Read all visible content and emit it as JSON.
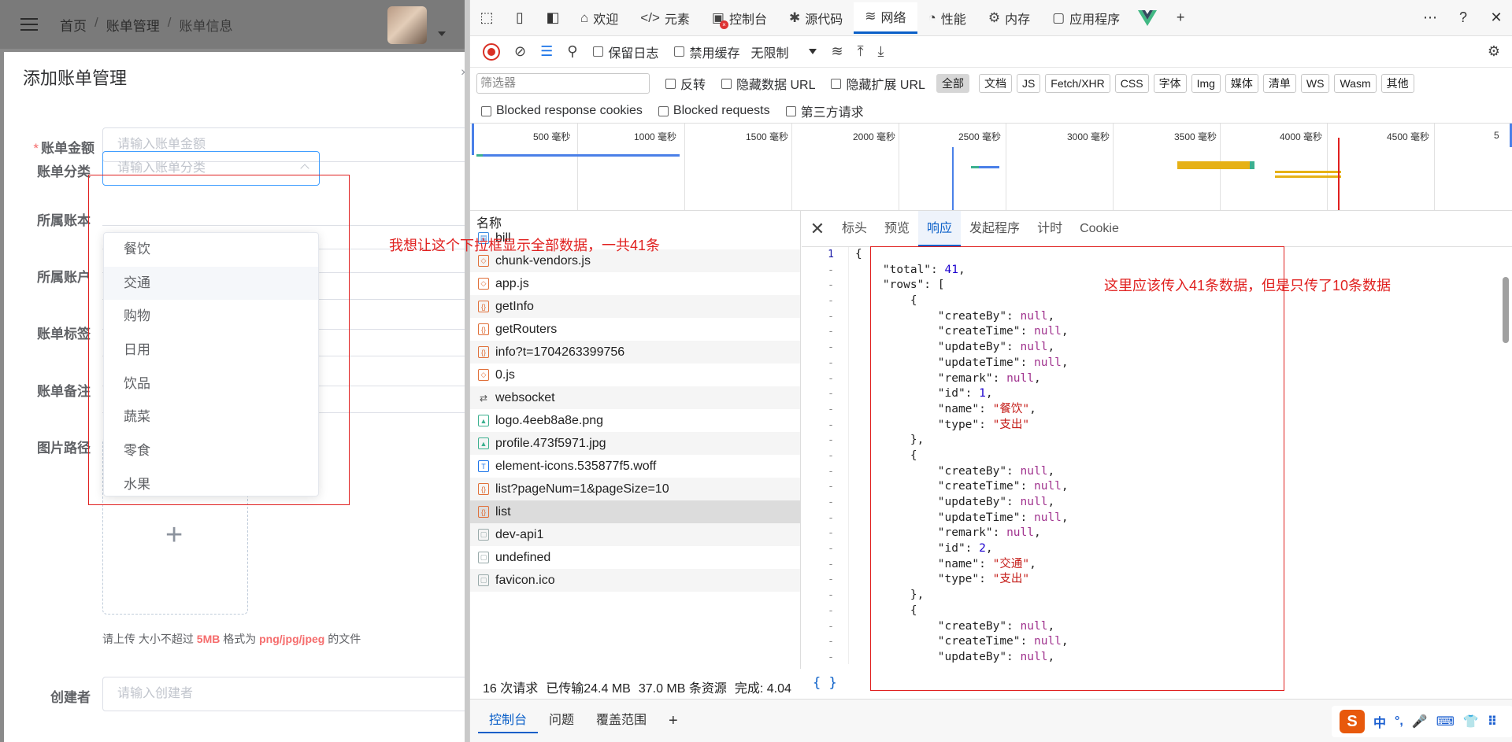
{
  "app": {
    "breadcrumb": [
      "首页",
      "账单管理",
      "账单信息"
    ],
    "dialog_title": "添加账单管理",
    "fields": {
      "amount": {
        "label": "账单金额",
        "placeholder": "请输入账单金额"
      },
      "category": {
        "label": "账单分类",
        "placeholder": "请输入账单分类"
      },
      "book": {
        "label": "所属账本"
      },
      "account": {
        "label": "所属账户"
      },
      "tag": {
        "label": "账单标签"
      },
      "remark": {
        "label": "账单备注"
      },
      "image": {
        "label": "图片路径"
      },
      "creator": {
        "label": "创建者",
        "placeholder": "请输入创建者"
      }
    },
    "upload_tip": {
      "pre": "请上传 大小不超过 ",
      "size": "5MB",
      "mid": " 格式为 ",
      "formats": "png/jpg/jpeg",
      "post": " 的文件"
    },
    "dropdown_options": [
      "餐饮",
      "交通",
      "购物",
      "日用",
      "饮品",
      "蔬菜",
      "零食",
      "水果"
    ],
    "annotation_dropdown": "我想让这个下拉框显示全部数据，一共41条",
    "annotation_response": "这里应该传入41条数据，但是只传了10条数据"
  },
  "devtools": {
    "tabs": [
      "欢迎",
      "元素",
      "控制台",
      "源代码",
      "网络",
      "性能",
      "内存",
      "应用程序"
    ],
    "toolbar": {
      "preserve_log": "保留日志",
      "disable_cache": "禁用缓存",
      "throttle": "无限制"
    },
    "filter": {
      "placeholder": "筛选器",
      "invert": "反转",
      "hide_data_url": "隐藏数据 URL",
      "hide_ext_url": "隐藏扩展 URL",
      "types": [
        "全部",
        "文档",
        "JS",
        "Fetch/XHR",
        "CSS",
        "字体",
        "Img",
        "媒体",
        "清单",
        "WS",
        "Wasm",
        "其他"
      ],
      "blocked_cookies": "Blocked response cookies",
      "blocked_requests": "Blocked requests",
      "third_party": "第三方请求"
    },
    "timeline_labels": [
      "500 毫秒",
      "1000 毫秒",
      "1500 毫秒",
      "2000 毫秒",
      "2500 毫秒",
      "3000 毫秒",
      "3500 毫秒",
      "4000 毫秒",
      "4500 毫秒",
      "5"
    ],
    "list_header": "名称",
    "requests": [
      {
        "name": "bill",
        "type": "doc"
      },
      {
        "name": "chunk-vendors.js",
        "type": "js"
      },
      {
        "name": "app.js",
        "type": "js"
      },
      {
        "name": "getInfo",
        "type": "xhr"
      },
      {
        "name": "getRouters",
        "type": "xhr"
      },
      {
        "name": "info?t=1704263399756",
        "type": "xhr"
      },
      {
        "name": "0.js",
        "type": "js"
      },
      {
        "name": "websocket",
        "type": "ws"
      },
      {
        "name": "logo.4eeb8a8e.png",
        "type": "img"
      },
      {
        "name": "profile.473f5971.jpg",
        "type": "img"
      },
      {
        "name": "element-icons.535877f5.woff",
        "type": "font"
      },
      {
        "name": "list?pageNum=1&pageSize=10",
        "type": "xhr"
      },
      {
        "name": "list",
        "type": "xhr"
      },
      {
        "name": "dev-api1",
        "type": "plain"
      },
      {
        "name": "undefined",
        "type": "plain"
      },
      {
        "name": "favicon.ico",
        "type": "plain"
      }
    ],
    "status": {
      "requests": "16 次请求",
      "transferred": "已传输24.4 MB",
      "resources": "37.0 MB 条资源",
      "finish": "完成: 4.04"
    },
    "detail_tabs": [
      "标头",
      "预览",
      "响应",
      "发起程序",
      "计时",
      "Cookie"
    ],
    "response_lines": [
      "{",
      "    \"total\": 41,",
      "    \"rows\": [",
      "        {",
      "            \"createBy\": null,",
      "            \"createTime\": null,",
      "            \"updateBy\": null,",
      "            \"updateTime\": null,",
      "            \"remark\": null,",
      "            \"id\": 1,",
      "            \"name\": \"餐饮\",",
      "            \"type\": \"支出\"",
      "        },",
      "        {",
      "            \"createBy\": null,",
      "            \"createTime\": null,",
      "            \"updateBy\": null,",
      "            \"updateTime\": null,",
      "            \"remark\": null,",
      "            \"id\": 2,",
      "            \"name\": \"交通\",",
      "            \"type\": \"支出\"",
      "        },",
      "        {",
      "            \"createBy\": null,",
      "            \"createTime\": null,",
      "            \"updateBy\": null,"
    ],
    "pretty_print": "{ }",
    "drawer_tabs": [
      "控制台",
      "问题",
      "覆盖范围"
    ],
    "ime": {
      "logo": "S",
      "lang": "中",
      "punct": "°,"
    }
  }
}
